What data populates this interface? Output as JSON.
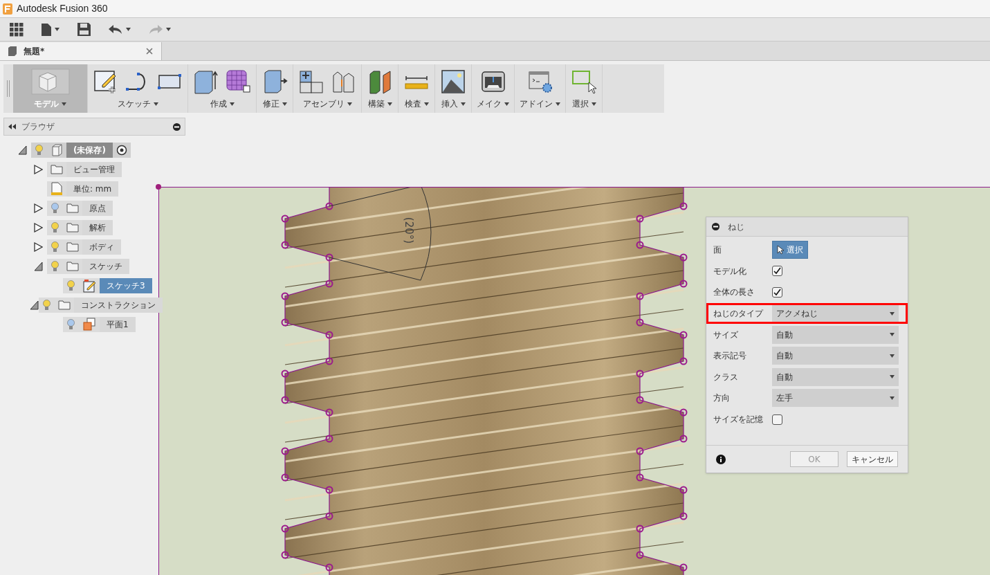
{
  "window": {
    "title": "Autodesk Fusion 360"
  },
  "quick_toolbar": [
    {
      "kind": "grid",
      "caret": false,
      "disabled": false
    },
    {
      "kind": "file",
      "caret": true,
      "disabled": false
    },
    {
      "kind": "save",
      "caret": false,
      "disabled": false
    },
    {
      "kind": "undo",
      "caret": true,
      "disabled": false
    },
    {
      "kind": "redo",
      "caret": true,
      "disabled": true
    }
  ],
  "tabs": [
    {
      "label": "無題*",
      "selected": true
    }
  ],
  "ribbon": [
    {
      "label": "モデル",
      "selected": true,
      "tools": [
        {
          "kind": "box"
        }
      ]
    },
    {
      "label": "スケッチ",
      "selected": false,
      "tools": [
        {
          "kind": "sketch"
        },
        {
          "kind": "arc"
        },
        {
          "kind": "rect"
        }
      ]
    },
    {
      "label": "作成",
      "selected": false,
      "tools": [
        {
          "kind": "extrude"
        },
        {
          "kind": "mesh"
        }
      ]
    },
    {
      "label": "修正",
      "selected": false,
      "tools": [
        {
          "kind": "modify"
        }
      ]
    },
    {
      "label": "アセンブリ",
      "selected": false,
      "tools": [
        {
          "kind": "assembly"
        },
        {
          "kind": "joint"
        }
      ]
    },
    {
      "label": "構築",
      "selected": false,
      "tools": [
        {
          "kind": "plane"
        }
      ]
    },
    {
      "label": "検査",
      "selected": false,
      "tools": [
        {
          "kind": "measure"
        }
      ]
    },
    {
      "label": "挿入",
      "selected": false,
      "tools": [
        {
          "kind": "image"
        }
      ]
    },
    {
      "label": "メイク",
      "selected": false,
      "tools": [
        {
          "kind": "make"
        }
      ]
    },
    {
      "label": "アドイン",
      "selected": false,
      "tools": [
        {
          "kind": "addin"
        }
      ]
    },
    {
      "label": "選択",
      "selected": false,
      "tools": [
        {
          "kind": "select"
        }
      ]
    }
  ],
  "browser": {
    "title": "ブラウザ",
    "tree": [
      {
        "label": "(未保存)",
        "kind": "component",
        "selected": false,
        "active": true,
        "visible": true,
        "expanded": true,
        "children": [
          {
            "label": "ビュー管理",
            "kind": "folder",
            "selected": false,
            "active": false,
            "expanded": false
          },
          {
            "label": "単位: mm",
            "kind": "units",
            "selected": false,
            "active": false
          },
          {
            "label": "原点",
            "kind": "folder",
            "selected": false,
            "active": false,
            "visible": false,
            "expanded": false
          },
          {
            "label": "解析",
            "kind": "folder",
            "selected": false,
            "active": false,
            "visible": true,
            "expanded": false
          },
          {
            "label": "ボディ",
            "kind": "folder",
            "selected": false,
            "active": false,
            "visible": true,
            "expanded": false
          },
          {
            "label": "スケッチ",
            "kind": "folder",
            "selected": false,
            "active": false,
            "visible": true,
            "expanded": true,
            "children": [
              {
                "label": "スケッチ3",
                "kind": "sketch",
                "selected": true,
                "active": false,
                "visible": true
              }
            ]
          },
          {
            "label": "コンストラクション",
            "kind": "folder",
            "selected": false,
            "active": false,
            "visible": true,
            "expanded": true,
            "children": [
              {
                "label": "平面1",
                "kind": "plane",
                "selected": false,
                "active": false,
                "visible": false
              }
            ]
          }
        ]
      }
    ]
  },
  "canvas": {
    "dimension_label": "(20°)"
  },
  "dialog": {
    "title": "ねじ",
    "rows": [
      {
        "label": "面",
        "kind": "select",
        "value": "選択",
        "highlighted": false
      },
      {
        "label": "モデル化",
        "kind": "checkbox",
        "checked": true,
        "highlighted": false
      },
      {
        "label": "全体の長さ",
        "kind": "checkbox",
        "checked": true,
        "highlighted": false
      },
      {
        "label": "ねじのタイプ",
        "kind": "dropdown",
        "value": "アクメねじ",
        "highlighted": true
      },
      {
        "label": "サイズ",
        "kind": "dropdown",
        "value": "自動",
        "highlighted": false
      },
      {
        "label": "表示記号",
        "kind": "dropdown",
        "value": "自動",
        "highlighted": false
      },
      {
        "label": "クラス",
        "kind": "dropdown",
        "value": "自動",
        "highlighted": false
      },
      {
        "label": "方向",
        "kind": "dropdown",
        "value": "左手",
        "highlighted": false
      },
      {
        "label": "サイズを記憶",
        "kind": "checkbox",
        "checked": false,
        "highlighted": false
      }
    ],
    "buttons": [
      {
        "label": "OK",
        "disabled": true
      },
      {
        "label": "キャンセル",
        "disabled": false
      }
    ]
  }
}
